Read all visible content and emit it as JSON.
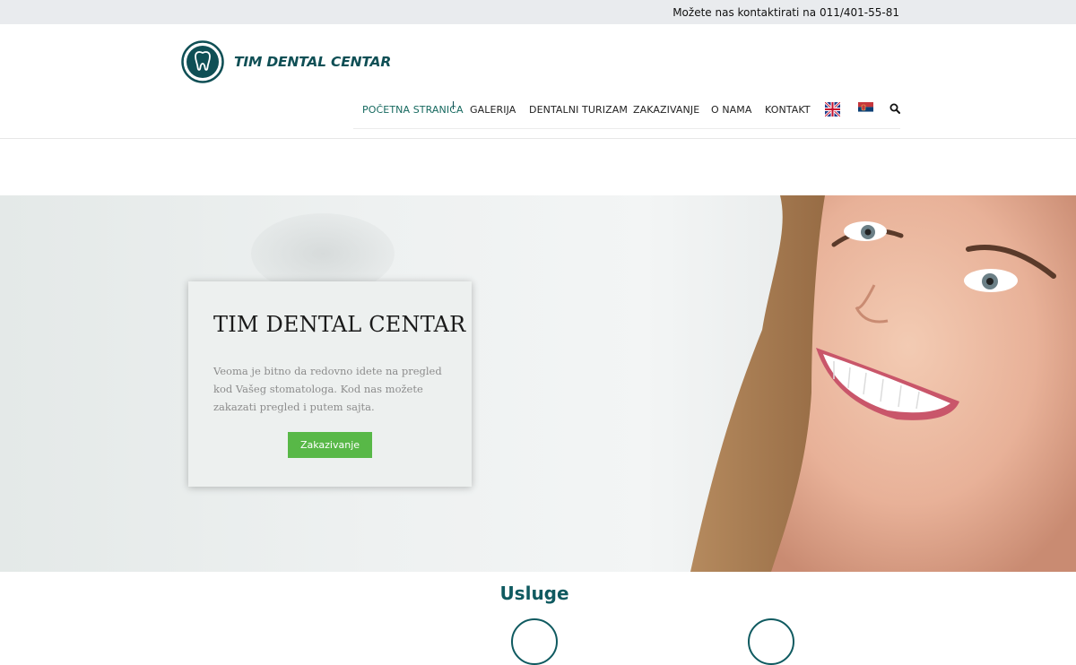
{
  "topbar": {
    "contact_text": "Možete nas kontaktirati na 011/401-55-81"
  },
  "logo": {
    "name": "TIM DENTAL CENTAR"
  },
  "nav": {
    "items": [
      {
        "label": "POČETNA STRANICA",
        "active": true
      },
      {
        "label": "GALERIJA"
      },
      {
        "label": "DENTALNI TURIZAM"
      },
      {
        "label": "ZAKAZIVANJE"
      },
      {
        "label": "O NAMA"
      },
      {
        "label": "KONTAKT"
      }
    ],
    "flags": [
      "uk-flag-icon",
      "serbia-flag-icon"
    ],
    "search_icon": "search-icon"
  },
  "hero": {
    "title": "TIM DENTAL CENTAR",
    "body": "Veoma je bitno da redovno idete na pregled kod Vašeg stomatologa. Kod nas možete zakazati pregled i putem sajta.",
    "button_label": "Zakazivanje"
  },
  "services": {
    "title": "Usluge"
  },
  "colors": {
    "brand": "#0f4f55",
    "accent_green": "#58b847",
    "active_nav": "#16695f"
  }
}
